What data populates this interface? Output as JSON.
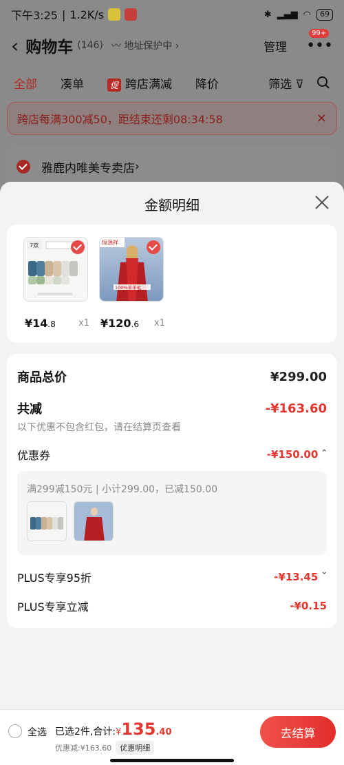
{
  "status": {
    "time": "下午3:25",
    "speed": "1.2K/s",
    "battery": "69"
  },
  "header": {
    "back_icon": "chevron-left-icon",
    "title": "购物车",
    "count": "(146)",
    "address_protect": "地址保护中",
    "manage": "管理",
    "more_badge": "99+"
  },
  "tabs": {
    "all": "全部",
    "bundle": "凑单",
    "promo_tag": "促",
    "cross_store": "跨店满减",
    "price_drop": "降价",
    "filter": "筛选"
  },
  "promo_bar": {
    "text": "跨店每满300减50，距结束还剩08:34:58"
  },
  "store": {
    "name": "雅鹿内唯美专卖店"
  },
  "sheet": {
    "title": "金额明细",
    "goods": [
      {
        "price_symbol": "¥",
        "price_int": "14",
        "price_dec": ".8",
        "qty": "x1",
        "thumb_label": "7双"
      },
      {
        "price_symbol": "¥",
        "price_int": "120",
        "price_dec": ".6",
        "qty": "x1",
        "thumb_label": "恒源祥",
        "thumb_caption": "100%羊羊毛"
      }
    ],
    "total_label": "商品总价",
    "total_value": "¥299.00",
    "discount_label": "共减",
    "discount_value": "-¥163.60",
    "discount_note": "以下优惠不包含红包，请在结算页查看",
    "coupon_label": "优惠券",
    "coupon_value": "-¥150.00",
    "coupon_desc": "满299减150元 | 小计299.00，已减150.00",
    "plus95_label": "PLUS专享95折",
    "plus95_value": "-¥13.45",
    "plus_cut_label": "PLUS专享立减",
    "plus_cut_value": "-¥0.15"
  },
  "footer": {
    "select_all": "全选",
    "selected_prefix": "已选2件,合计:",
    "currency": "¥",
    "total_int": "135",
    "total_dec": ".40",
    "saved": "优惠减:¥163.60",
    "detail_pill": "优惠明细",
    "checkout": "去结算"
  },
  "colors": {
    "accent_red": "#e5372f",
    "checkout_gradient_start": "#f0524a"
  }
}
